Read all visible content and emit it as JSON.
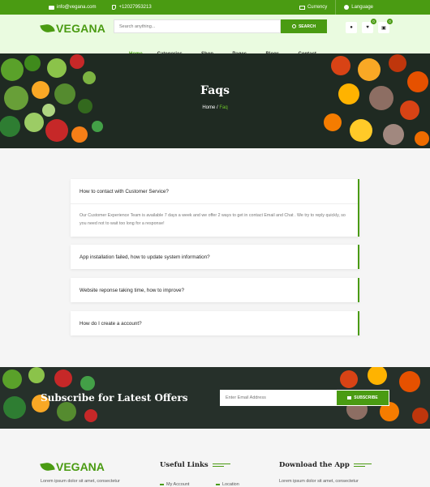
{
  "topbar": {
    "email": "info@vegana.com",
    "phone": "+12027953213",
    "currency": "Currency",
    "language": "Language"
  },
  "header": {
    "logo_text": "VEGANA",
    "search_placeholder": "Search anything...",
    "search_button": "SEARCH",
    "wishlist_count": "0",
    "cart_count": "0"
  },
  "nav": {
    "items": [
      {
        "label": "Home",
        "active": true
      },
      {
        "label": "Categories",
        "dropdown": true
      },
      {
        "label": "Shop",
        "dropdown": true
      },
      {
        "label": "Pages",
        "dropdown": true
      },
      {
        "label": "Blogs",
        "dropdown": true
      },
      {
        "label": "Contact"
      }
    ],
    "caret": "⌄"
  },
  "hero": {
    "title": "Faqs",
    "breadcrumb_home": "Home",
    "breadcrumb_sep": "/",
    "breadcrumb_current": "Faq"
  },
  "faqs": [
    {
      "question": "How to contact with Customer Service?",
      "answer": "Our Customer Experience Team is available 7 days a week and we offer 2 ways to get in contact Email and Chat . We try to reply quickly, so you need not to wait too long for a response!"
    },
    {
      "question": "App installation failed, how to update system information?"
    },
    {
      "question": "Website reponse taking time, how to improve?"
    },
    {
      "question": "How do I create a account?"
    }
  ],
  "subscribe": {
    "title": "Subscribe for Latest Offers",
    "placeholder": "Enter Email Address",
    "button": "SUBSCRIBE"
  },
  "footer": {
    "logo_text": "VEGANA",
    "description": "Lorem ipsum dolor sit amet, consectetur",
    "col2_title": "Useful Links",
    "col2_links": [
      "My Account",
      "Location"
    ],
    "col3_title": "Download the App",
    "col3_text": "Lorem ipsum dolor sit amet, consectetur"
  },
  "colors": {
    "brand_green": "#4a9b12",
    "header_bg": "#eafbe0"
  }
}
